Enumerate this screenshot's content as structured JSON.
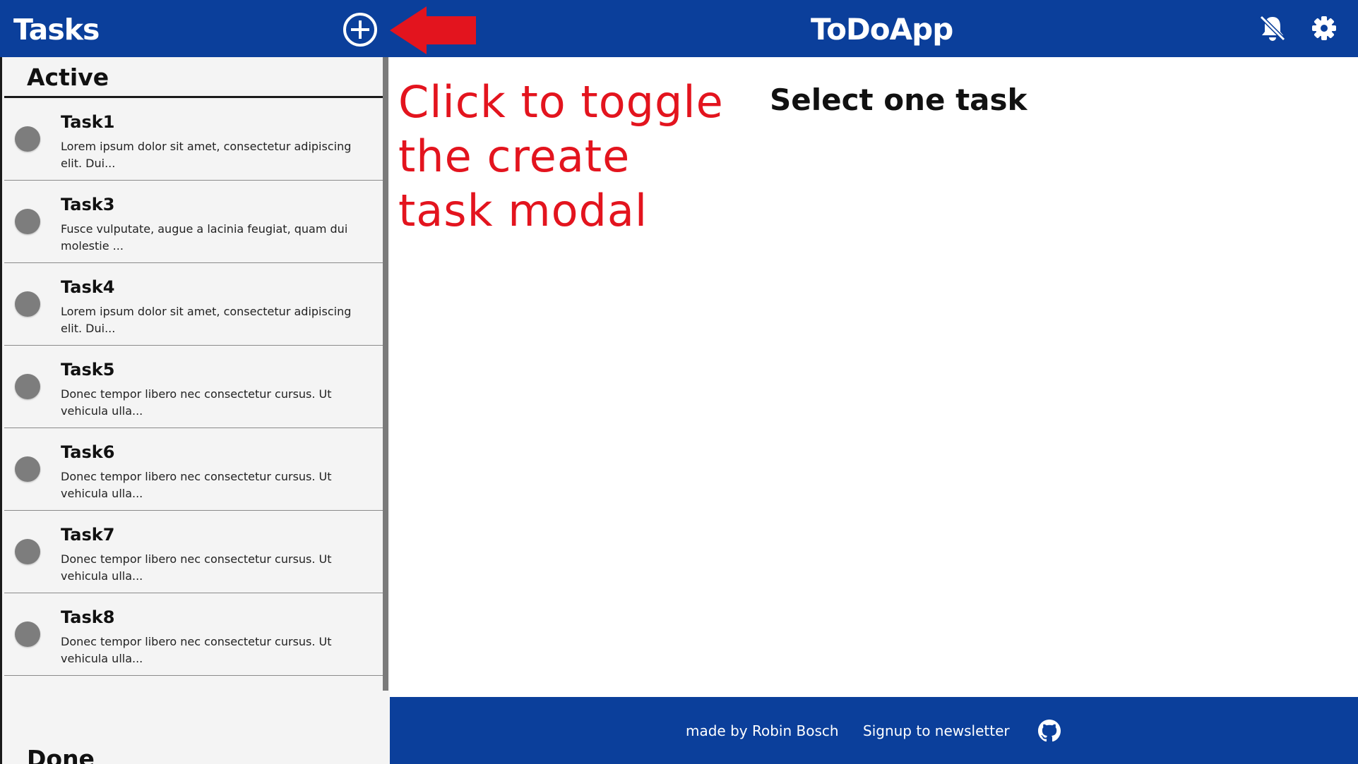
{
  "header": {
    "title": "Tasks",
    "app_title": "ToDoApp",
    "add_icon": "plus-circle-icon",
    "notifications_icon": "bell-off-icon",
    "settings_icon": "gear-icon"
  },
  "annotation": {
    "text": "Click to toggle the create task modal",
    "arrow_icon": "arrow-left-icon"
  },
  "sidebar": {
    "active_label": "Active",
    "done_label": "Done",
    "tasks": [
      {
        "title": "Task1",
        "desc": "Lorem ipsum dolor sit amet, consectetur adipiscing elit. Dui..."
      },
      {
        "title": "Task3",
        "desc": "Fusce vulputate, augue a lacinia feugiat, quam dui molestie ..."
      },
      {
        "title": "Task4",
        "desc": "Lorem ipsum dolor sit amet, consectetur adipiscing elit. Dui..."
      },
      {
        "title": "Task5",
        "desc": "Donec tempor libero nec consectetur cursus. Ut vehicula ulla..."
      },
      {
        "title": "Task6",
        "desc": "Donec tempor libero nec consectetur cursus. Ut vehicula ulla..."
      },
      {
        "title": "Task7",
        "desc": "Donec tempor libero nec consectetur cursus. Ut vehicula ulla..."
      },
      {
        "title": "Task8",
        "desc": "Donec tempor libero nec consectetur cursus. Ut vehicula ulla..."
      }
    ]
  },
  "main": {
    "placeholder": "Select one task"
  },
  "footer": {
    "credit": "made by Robin Bosch",
    "newsletter": "Signup to newsletter",
    "github_icon": "github-icon"
  },
  "colors": {
    "primary": "#0b3f9b",
    "annotation": "#e3141e",
    "sidebar_bg": "#f4f4f4",
    "status_dot": "#7d7d7d"
  }
}
